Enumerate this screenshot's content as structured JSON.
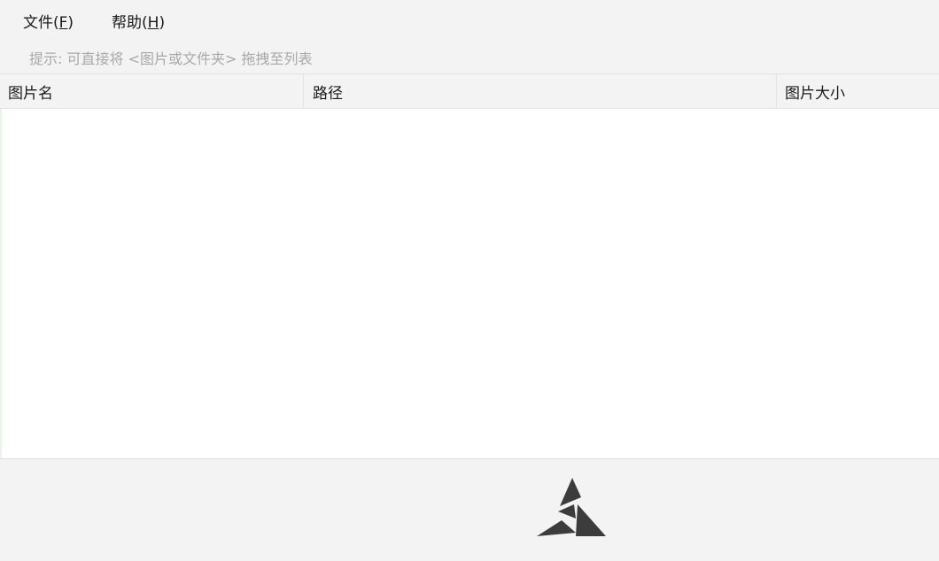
{
  "menu": {
    "file_label": "文件(",
    "file_hotkey": "F",
    "file_close": ")",
    "help_label": "帮助(",
    "help_hotkey": "H",
    "help_close": ")"
  },
  "hint": "提示: 可直接将 <图片或文件夹> 拖拽至列表",
  "columns": [
    "图片名",
    "路径",
    "图片大小"
  ],
  "rows": [],
  "logo": {
    "icon": "triangle-logo-icon",
    "color": "#3c3c3c"
  }
}
